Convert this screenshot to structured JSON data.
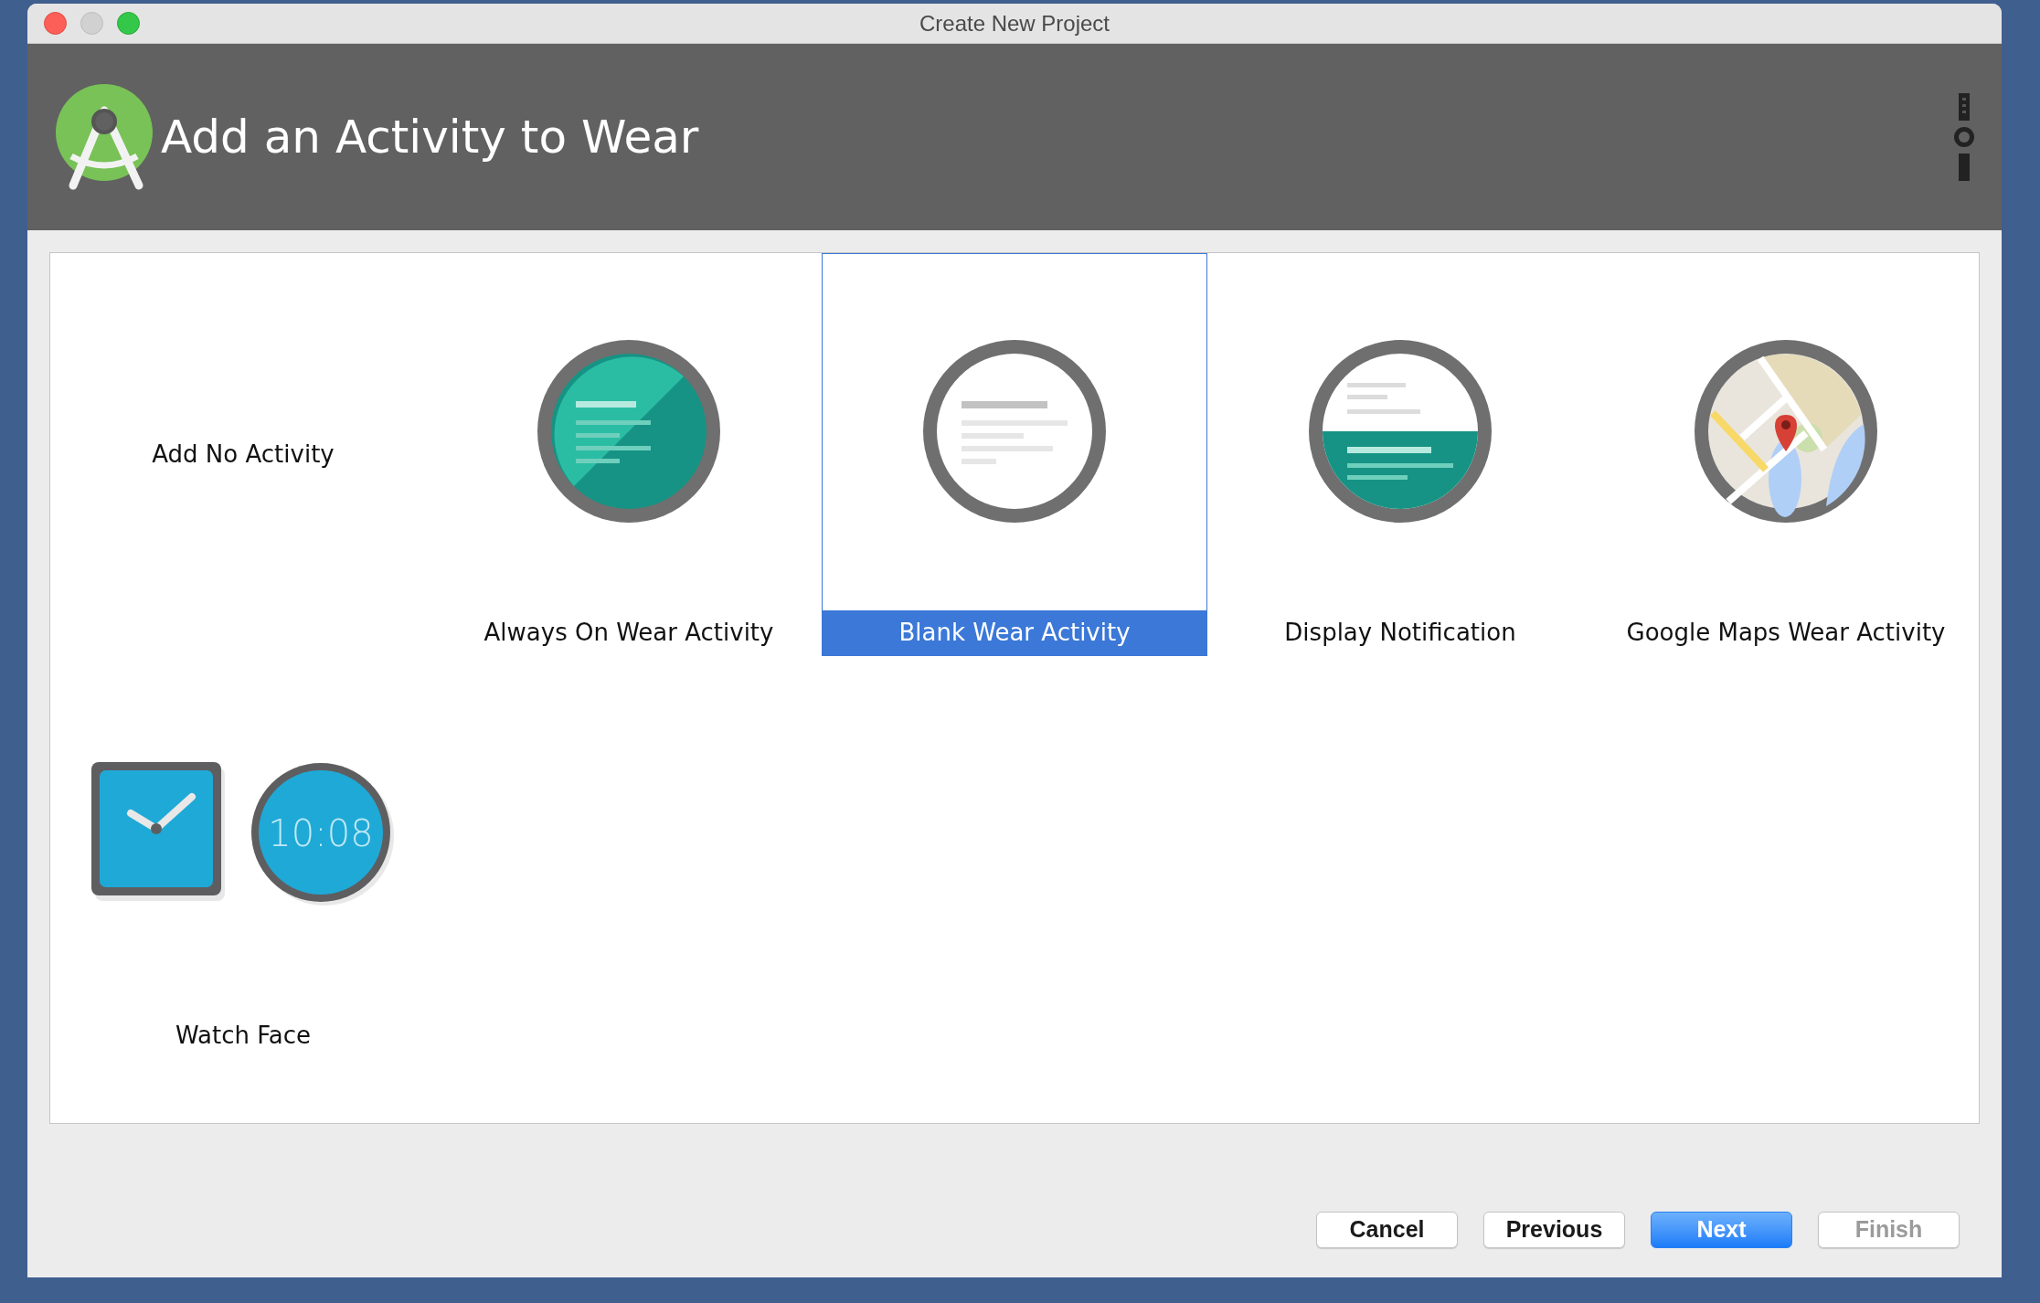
{
  "window": {
    "title": "Create New Project"
  },
  "header": {
    "title": "Add an Activity to Wear"
  },
  "tiles": [
    {
      "kind": "none",
      "label": "Add No Activity",
      "selected": false
    },
    {
      "kind": "always_on",
      "label": "Always On Wear Activity",
      "selected": false
    },
    {
      "kind": "blank",
      "label": "Blank Wear Activity",
      "selected": true
    },
    {
      "kind": "notification",
      "label": "Display Notification",
      "selected": false
    },
    {
      "kind": "maps",
      "label": "Google Maps Wear Activity",
      "selected": false
    },
    {
      "kind": "watch_face",
      "label": "Watch Face",
      "selected": false,
      "time": "10:08"
    }
  ],
  "buttons": [
    {
      "label": "Cancel",
      "kind": "default",
      "disabled": false
    },
    {
      "label": "Previous",
      "kind": "default",
      "disabled": false
    },
    {
      "label": "Next",
      "kind": "primary",
      "disabled": false
    },
    {
      "label": "Finish",
      "kind": "default",
      "disabled": true
    }
  ]
}
